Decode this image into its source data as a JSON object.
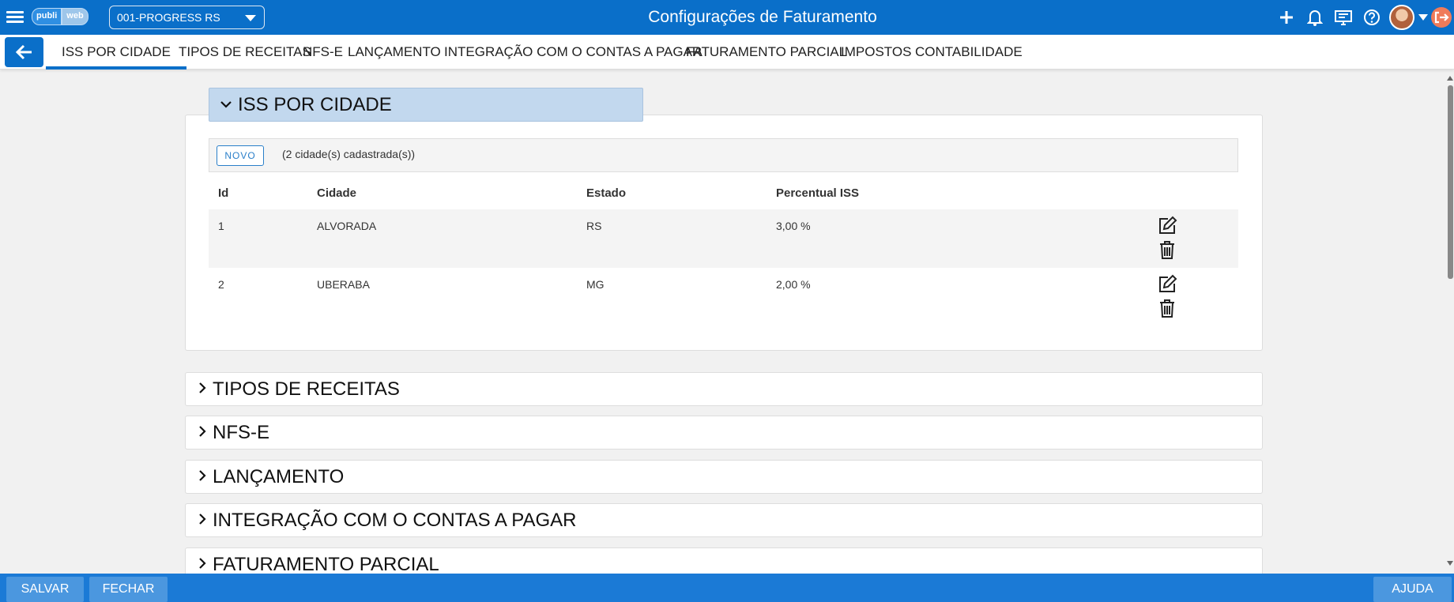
{
  "header": {
    "logo": {
      "part1": "publi",
      "part2": "web"
    },
    "company_select": "001-PROGRESS RS",
    "title": "Configurações de Faturamento"
  },
  "tabs": [
    {
      "label": "ISS POR CIDADE"
    },
    {
      "label": "TIPOS DE RECEITAS"
    },
    {
      "label": "NFS-E"
    },
    {
      "label": "LANÇAMENTO"
    },
    {
      "label": "INTEGRAÇÃO COM O CONTAS A PAGAR"
    },
    {
      "label": "FATURAMENTO PARCIAL"
    },
    {
      "label": "IMPOSTOS"
    },
    {
      "label": "CONTABILIDADE"
    }
  ],
  "iss_section": {
    "title": "ISS POR CIDADE",
    "novo_label": "NOVO",
    "count_text": "(2  cidade(s) cadastrada(s))",
    "columns": [
      "Id",
      "Cidade",
      "Estado",
      "Percentual ISS"
    ],
    "rows": [
      {
        "id": "1",
        "cidade": "ALVORADA",
        "estado": "RS",
        "percentual": "3,00 %"
      },
      {
        "id": "2",
        "cidade": "UBERABA",
        "estado": "MG",
        "percentual": "2,00 %"
      }
    ]
  },
  "collapsed_sections": [
    {
      "title": "TIPOS DE RECEITAS"
    },
    {
      "title": "NFS-E"
    },
    {
      "title": "LANÇAMENTO"
    },
    {
      "title": "INTEGRAÇÃO COM O CONTAS A PAGAR"
    },
    {
      "title": "FATURAMENTO PARCIAL"
    }
  ],
  "footer": {
    "save": "SALVAR",
    "close": "FECHAR",
    "help": "AJUDA"
  },
  "colors": {
    "primary": "#0a6fc9",
    "section_header": "#c2d8ee",
    "footer": "#1b7ad6"
  }
}
